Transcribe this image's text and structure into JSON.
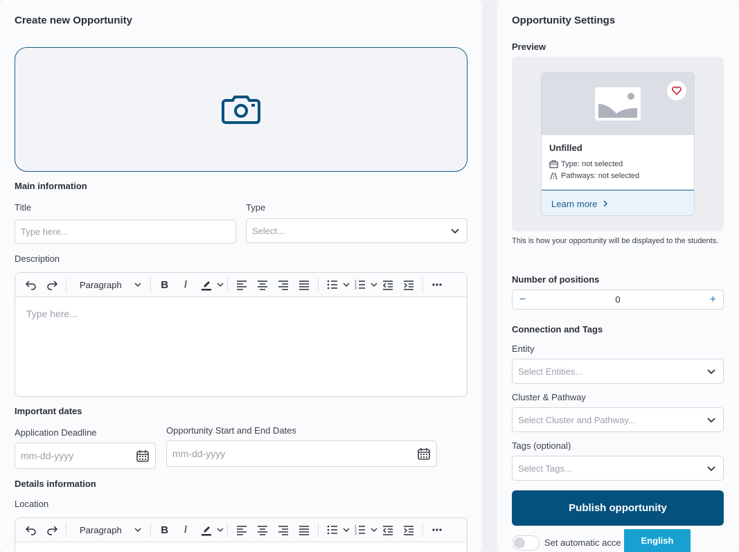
{
  "left": {
    "title": "Create new Opportunity",
    "main_info": "Main information",
    "title_label": "Title",
    "title_placeholder": "Type here...",
    "type_label": "Type",
    "type_placeholder": "Select...",
    "description_label": "Description",
    "editor": {
      "paragraph": "Paragraph",
      "placeholder": "Type here..."
    },
    "dates_heading": "Important dates",
    "deadline_label": "Application Deadline",
    "deadline_placeholder": "mm-dd-yyyy",
    "start_end_label": "Opportunity Start and End Dates",
    "start_end_placeholder": "mm-dd-yyyy",
    "details_heading": "Details information",
    "location_label": "Location"
  },
  "right": {
    "title": "Opportunity Settings",
    "preview_label": "Preview",
    "card": {
      "title": "Unfilled",
      "type_line": "Type: not selected",
      "pathways_line": "Pathways: not selected",
      "learn_more": "Learn more"
    },
    "preview_note": "This is how your opportunity will be displayed to the students.",
    "positions_label": "Number of positions",
    "positions_value": "0",
    "connection_heading": "Connection and Tags",
    "entity_label": "Entity",
    "entity_placeholder": "Select Entities...",
    "cluster_label": "Cluster & Pathway",
    "cluster_placeholder": "Select Cluster and Pathway...",
    "tags_label": "Tags (optional)",
    "tags_placeholder": "Select Tags...",
    "publish_label": "Publish opportunity",
    "auto_label": "Set automatic acce"
  },
  "language_button": "English",
  "colors": {
    "primary": "#05517e",
    "accent": "#17a0d0",
    "heart": "#c8102e"
  }
}
